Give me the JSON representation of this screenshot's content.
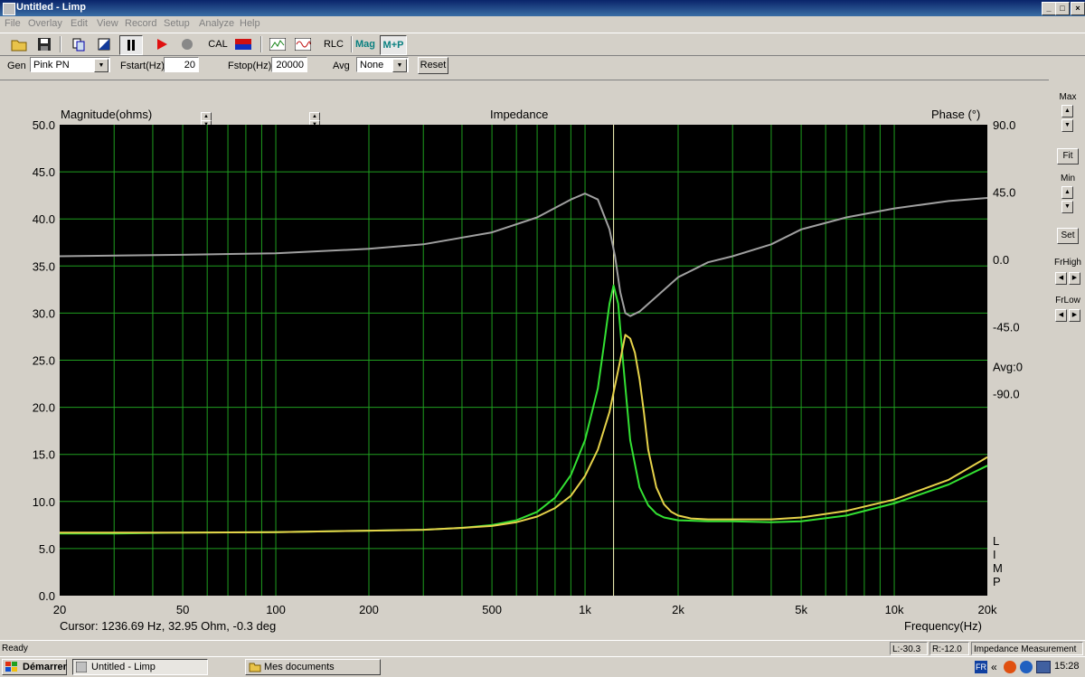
{
  "window": {
    "title": "Untitled - Limp"
  },
  "menu": [
    "File",
    "Overlay",
    "Edit",
    "View",
    "Record",
    "Setup",
    "Analyze",
    "Help"
  ],
  "toolbar": {
    "cal": "CAL",
    "rlc": "RLC",
    "mag": "Mag",
    "mp": "M+P"
  },
  "params": {
    "gen_label": "Gen",
    "gen_value": "Pink PN",
    "fstart_label": "Fstart(Hz)",
    "fstart_value": "20",
    "fstop_label": "Fstop(Hz)",
    "fstop_value": "20000",
    "avg_label": "Avg",
    "avg_value": "None",
    "reset": "Reset"
  },
  "side": {
    "max": "Max",
    "fit": "Fit",
    "min": "Min",
    "set": "Set",
    "frhigh": "FrHigh",
    "frlow": "FrLow"
  },
  "chart_data": {
    "type": "line",
    "title": "Impedance",
    "ylabel": "Magnitude(ohms)",
    "y2label": "Phase (°)",
    "xlabel": "Frequency(Hz)",
    "xscale": "log",
    "xlim": [
      20,
      20000
    ],
    "ylim": [
      0,
      50
    ],
    "y2lim": [
      -225,
      90
    ],
    "yticks": [
      "0.0",
      "5.0",
      "10.0",
      "15.0",
      "20.0",
      "25.0",
      "30.0",
      "35.0",
      "40.0",
      "45.0",
      "50.0"
    ],
    "y2ticks": [
      {
        "v": 90,
        "label": "90.0"
      },
      {
        "v": 45,
        "label": "45.0"
      },
      {
        "v": 0,
        "label": "0.0"
      },
      {
        "v": -45,
        "label": "-45.0"
      },
      {
        "v": -90,
        "label": "-90.0"
      }
    ],
    "xticks": [
      {
        "v": 20,
        "label": "20"
      },
      {
        "v": 50,
        "label": "50"
      },
      {
        "v": 100,
        "label": "100"
      },
      {
        "v": 200,
        "label": "200"
      },
      {
        "v": 500,
        "label": "500"
      },
      {
        "v": 1000,
        "label": "1k"
      },
      {
        "v": 2000,
        "label": "2k"
      },
      {
        "v": 5000,
        "label": "5k"
      },
      {
        "v": 10000,
        "label": "10k"
      },
      {
        "v": 20000,
        "label": "20k"
      }
    ],
    "avg_label": "Avg:0",
    "limp_label": [
      "L",
      "I",
      "M",
      "P"
    ],
    "cursor_x": 1236.69,
    "cursor_text": "Cursor: 1236.69 Hz, 32.95 Ohm, -0.3 deg",
    "colors": {
      "background": "#000000",
      "grid": "#1f9e1f",
      "green": "#33e033",
      "yellow": "#e6d24a",
      "phase": "#a0a0a0",
      "cursor": "#ffffc0"
    },
    "series": [
      {
        "color": "green",
        "axis": "left",
        "x": [
          20,
          30,
          50,
          100,
          200,
          300,
          400,
          500,
          600,
          700,
          800,
          900,
          1000,
          1100,
          1150,
          1200,
          1237,
          1280,
          1330,
          1400,
          1500,
          1600,
          1700,
          1800,
          2000,
          2500,
          3000,
          4000,
          5000,
          7000,
          10000,
          15000,
          20000
        ],
        "y": [
          6.6,
          6.6,
          6.7,
          6.75,
          6.9,
          7.0,
          7.2,
          7.5,
          8.0,
          8.9,
          10.4,
          12.8,
          16.5,
          22.0,
          26.5,
          31.0,
          32.95,
          31.0,
          24.5,
          16.5,
          11.5,
          9.6,
          8.7,
          8.3,
          8.0,
          7.9,
          7.9,
          7.8,
          7.9,
          8.5,
          9.8,
          11.8,
          13.8
        ]
      },
      {
        "color": "yellow",
        "axis": "left",
        "x": [
          20,
          50,
          100,
          200,
          300,
          400,
          500,
          600,
          700,
          800,
          900,
          1000,
          1100,
          1200,
          1300,
          1350,
          1400,
          1450,
          1500,
          1550,
          1600,
          1700,
          1800,
          1900,
          2000,
          2200,
          2500,
          3000,
          4000,
          5000,
          7000,
          10000,
          15000,
          20000
        ],
        "y": [
          6.7,
          6.7,
          6.75,
          6.9,
          7.0,
          7.2,
          7.4,
          7.8,
          8.4,
          9.3,
          10.6,
          12.7,
          15.5,
          19.5,
          25.0,
          27.7,
          27.3,
          25.8,
          23.0,
          19.5,
          15.5,
          11.5,
          9.7,
          8.9,
          8.5,
          8.2,
          8.1,
          8.1,
          8.1,
          8.3,
          9.0,
          10.2,
          12.3,
          14.7
        ]
      },
      {
        "color": "phase",
        "axis": "right",
        "x": [
          20,
          50,
          100,
          200,
          300,
          500,
          700,
          900,
          1000,
          1100,
          1200,
          1250,
          1300,
          1350,
          1400,
          1500,
          1700,
          2000,
          2500,
          3000,
          4000,
          5000,
          7000,
          10000,
          15000,
          20000
        ],
        "y": [
          2,
          3,
          4,
          7,
          10,
          18,
          28,
          40,
          44,
          40,
          20,
          2,
          -22,
          -36,
          -38,
          -35,
          -25,
          -12,
          -2,
          2,
          10,
          20,
          28,
          34,
          39,
          41
        ]
      }
    ]
  },
  "status": {
    "ready": "Ready",
    "left_level": "L:-30.3",
    "right_level": "R:-12.0",
    "mode": "Impedance Measurement"
  },
  "taskbar": {
    "start": "Démarrer",
    "task1": "Untitled - Limp",
    "task2": "Mes documents",
    "lang": "FR",
    "tray": "«",
    "clock": "15:28"
  }
}
